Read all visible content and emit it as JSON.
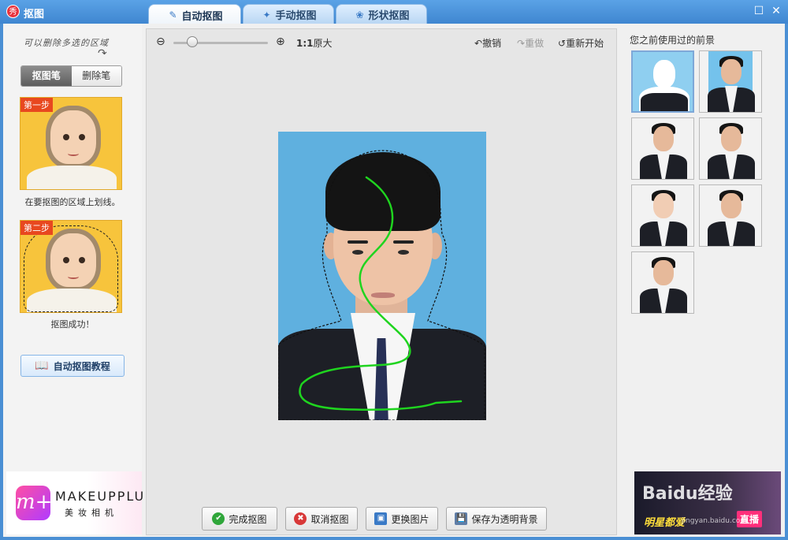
{
  "window": {
    "title": "抠图",
    "app_icon_char": "秀"
  },
  "tabs": [
    {
      "label": "自动抠图",
      "icon": "brush-icon",
      "active": true
    },
    {
      "label": "手动抠图",
      "icon": "magic-wand-icon",
      "active": false
    },
    {
      "label": "形状抠图",
      "icon": "shape-icon",
      "active": false
    }
  ],
  "left": {
    "hint": "可以删除多选的区域",
    "mode": {
      "pen": "抠图笔",
      "eraser": "删除笔"
    },
    "step1": {
      "badge": "第一步",
      "caption": "在要抠图的区域上划线。"
    },
    "step2": {
      "badge": "第二步",
      "caption": "抠图成功！"
    },
    "tutorial_label": "自动抠图教程",
    "ad": {
      "brand": "MAKEUPPLUS",
      "sub": "美妆相机",
      "logo": "m+"
    }
  },
  "toolbar": {
    "zoom_ratio": "1:1",
    "original_size": "原大",
    "undo": "撤销",
    "redo": "重做",
    "restart": "重新开始",
    "zoom_level": 0.2
  },
  "bottom": {
    "finish": "完成抠图",
    "cancel": "取消抠图",
    "replace": "更换图片",
    "save": "保存为透明背景"
  },
  "right": {
    "title": "您之前使用过的前景"
  },
  "ad_right": {
    "brand": "Baidu经验",
    "url": "jingyan.baidu.com",
    "text": "明星都爱",
    "tag": "直播"
  },
  "colors": {
    "accent": "#3f86d0",
    "stroke_green": "#1fd41f",
    "photo_bg": "#5fb0df"
  }
}
